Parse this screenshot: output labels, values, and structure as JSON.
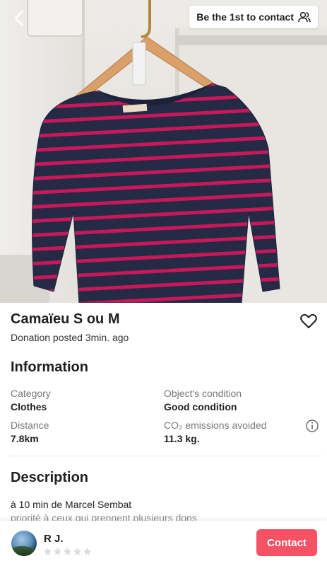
{
  "header": {
    "contact_pill_label": "Be the 1st to contact"
  },
  "item": {
    "title": "Camaïeu S ou M",
    "posted": "Donation posted 3min. ago"
  },
  "information": {
    "heading": "Information",
    "category_label": "Category",
    "category_value": "Clothes",
    "condition_label": "Object's condition",
    "condition_value": "Good condition",
    "distance_label": "Distance",
    "distance_value": "7.8km",
    "co2_label": "CO₂ emissions avoided",
    "co2_value": "11.3 kg."
  },
  "description": {
    "heading": "Description",
    "line1": "à 10 min de Marcel Sembat",
    "line2": "priorité à ceux qui prennent plusieurs dons"
  },
  "user": {
    "name": "R J.",
    "rating": 0,
    "max_rating": 5
  },
  "actions": {
    "contact_label": "Contact"
  },
  "colors": {
    "accent": "#f55266",
    "stripe_navy": "#252a45",
    "stripe_pink": "#c8185a"
  }
}
